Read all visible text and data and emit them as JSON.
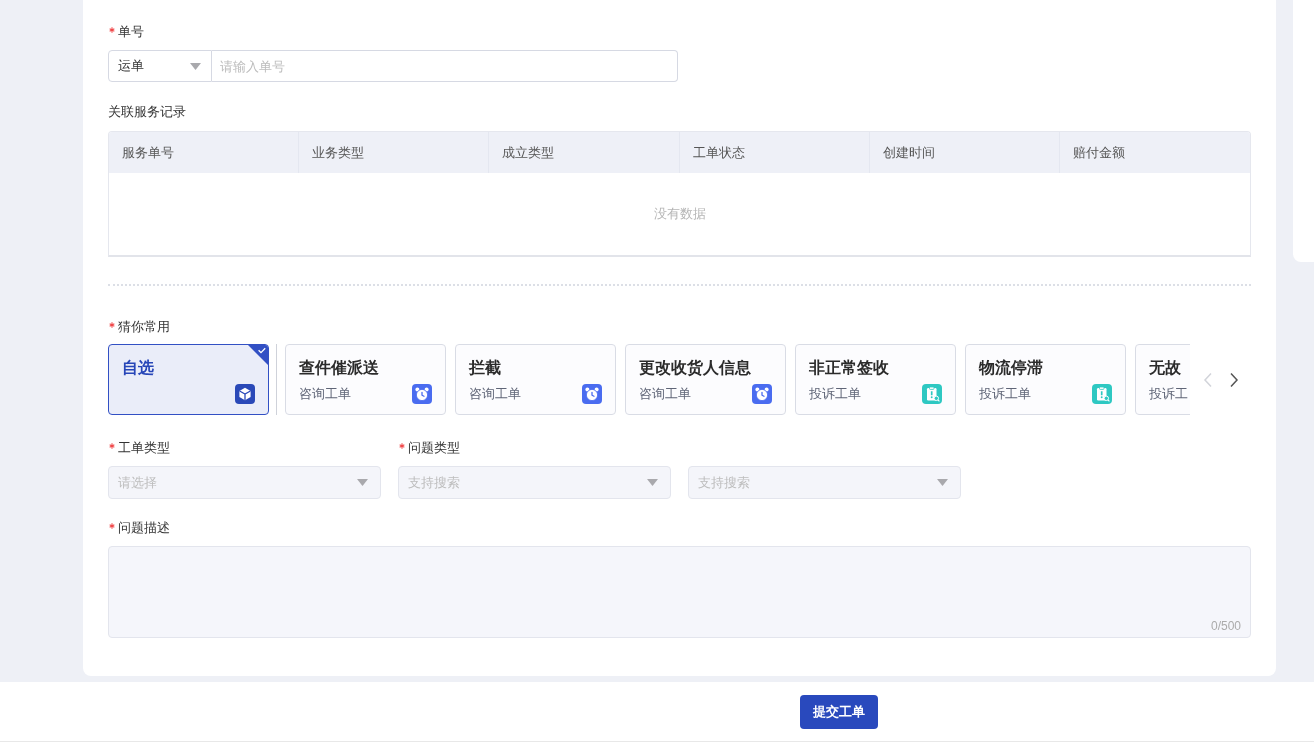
{
  "waybill": {
    "label": "单号",
    "required": true,
    "type_select": {
      "value": "运单"
    },
    "number_input": {
      "placeholder": "请输入单号"
    }
  },
  "service_records": {
    "title": "关联服务记录",
    "columns": [
      "服务单号",
      "业务类型",
      "成立类型",
      "工单状态",
      "创建时间",
      "赔付金额"
    ],
    "empty_text": "没有数据"
  },
  "frequent": {
    "label": "猜你常用",
    "required": true,
    "cards": [
      {
        "title": "自选",
        "kind": "custom",
        "selected": true
      },
      {
        "title": "查件催派送",
        "subtitle": "咨询工单",
        "kind": "consult",
        "selected": false
      },
      {
        "title": "拦截",
        "subtitle": "咨询工单",
        "kind": "consult",
        "selected": false
      },
      {
        "title": "更改收货人信息",
        "subtitle": "咨询工单",
        "kind": "consult",
        "selected": false
      },
      {
        "title": "非正常签收",
        "subtitle": "投诉工单",
        "kind": "complaint",
        "selected": false
      },
      {
        "title": "物流停滞",
        "subtitle": "投诉工单",
        "kind": "complaint",
        "selected": false
      },
      {
        "title": "无故",
        "subtitle": "投诉工",
        "selected": false
      }
    ],
    "prev_disabled": true,
    "next_disabled": false
  },
  "ticket_type": {
    "label": "工单类型",
    "required": true,
    "placeholder": "请选择"
  },
  "issue_type": {
    "label": "问题类型",
    "required": true,
    "selects": [
      {
        "placeholder": "支持搜索"
      },
      {
        "placeholder": "支持搜索"
      }
    ]
  },
  "description": {
    "label": "问题描述",
    "required": true,
    "counter": "0/500"
  },
  "submit_button": {
    "label": "提交工单"
  }
}
